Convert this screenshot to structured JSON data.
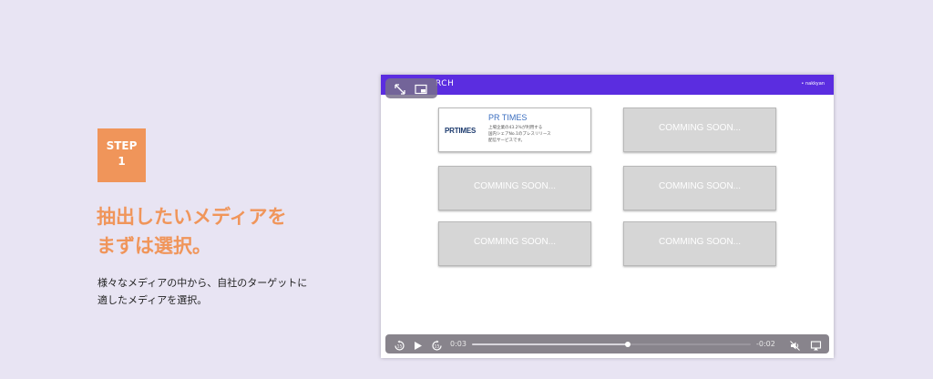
{
  "step": {
    "label": "STEP",
    "number": "1"
  },
  "headline": [
    "抽出したいメディアを",
    "まずは選択。"
  ],
  "description": [
    "様々なメディアの中から、自社のターゲットに",
    "適したメディアを選択。"
  ],
  "screen": {
    "app_title": "RCH",
    "user": "• nakkyan",
    "pip": {
      "expand_icon": "expand-arrows-icon",
      "pip_icon": "picture-in-picture-icon"
    },
    "cards": {
      "prtimes": {
        "logo": "PRTIMES",
        "title": "PR TIMES",
        "desc": [
          "上場企業の43.2%が利用する",
          "国内シェアNo.1のプレスリリース",
          "配信サービスです。"
        ]
      },
      "soon_label": "COMMING SOON..."
    },
    "video": {
      "current_time": "0:03",
      "remaining_time": "-0:02",
      "progress": 0.56,
      "icons": [
        "skip-back-15-icon",
        "play-icon",
        "skip-forward-15-icon",
        "mute-icon",
        "airplay-icon"
      ]
    }
  },
  "colors": {
    "accent": "#f0955a",
    "topbar": "#5b2de0",
    "background": "#e8e4f3"
  }
}
